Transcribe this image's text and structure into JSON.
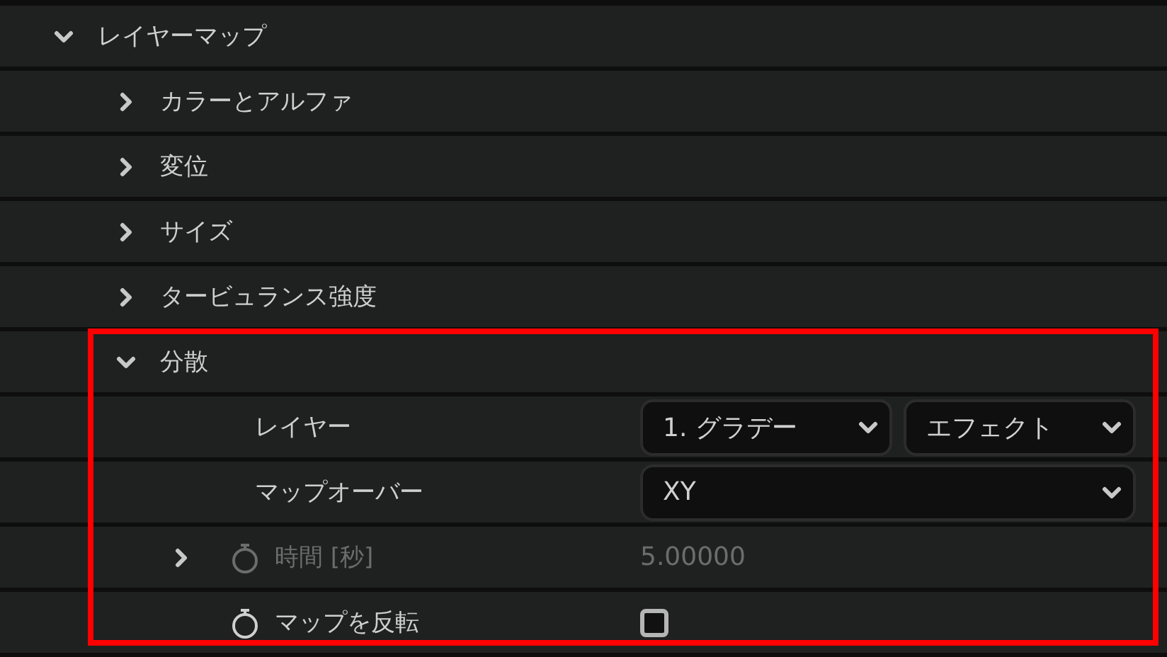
{
  "tree": [
    {
      "label": "レイヤーマップ",
      "expanded": true,
      "children": [
        {
          "label": "カラーとアルファ",
          "expanded": false
        },
        {
          "label": "変位",
          "expanded": false
        },
        {
          "label": "サイズ",
          "expanded": false
        },
        {
          "label": "タービュランス強度",
          "expanded": false
        },
        {
          "label": "分散",
          "expanded": true,
          "highlighted": true,
          "properties": [
            {
              "kind": "popups",
              "label": "レイヤー",
              "popups": [
                {
                  "value": "1. グラデー"
                },
                {
                  "value": "エフェクト"
                }
              ]
            },
            {
              "kind": "popup",
              "label": "マップオーバー",
              "value": "XY"
            },
            {
              "kind": "number",
              "label": "時間 [秒]",
              "value": "5.00000",
              "expandable": true,
              "expanded": false,
              "disabled": true,
              "keyframe": true
            },
            {
              "kind": "checkbox",
              "label": "マップを反転",
              "checked": false,
              "keyframe": true
            }
          ]
        }
      ]
    }
  ]
}
